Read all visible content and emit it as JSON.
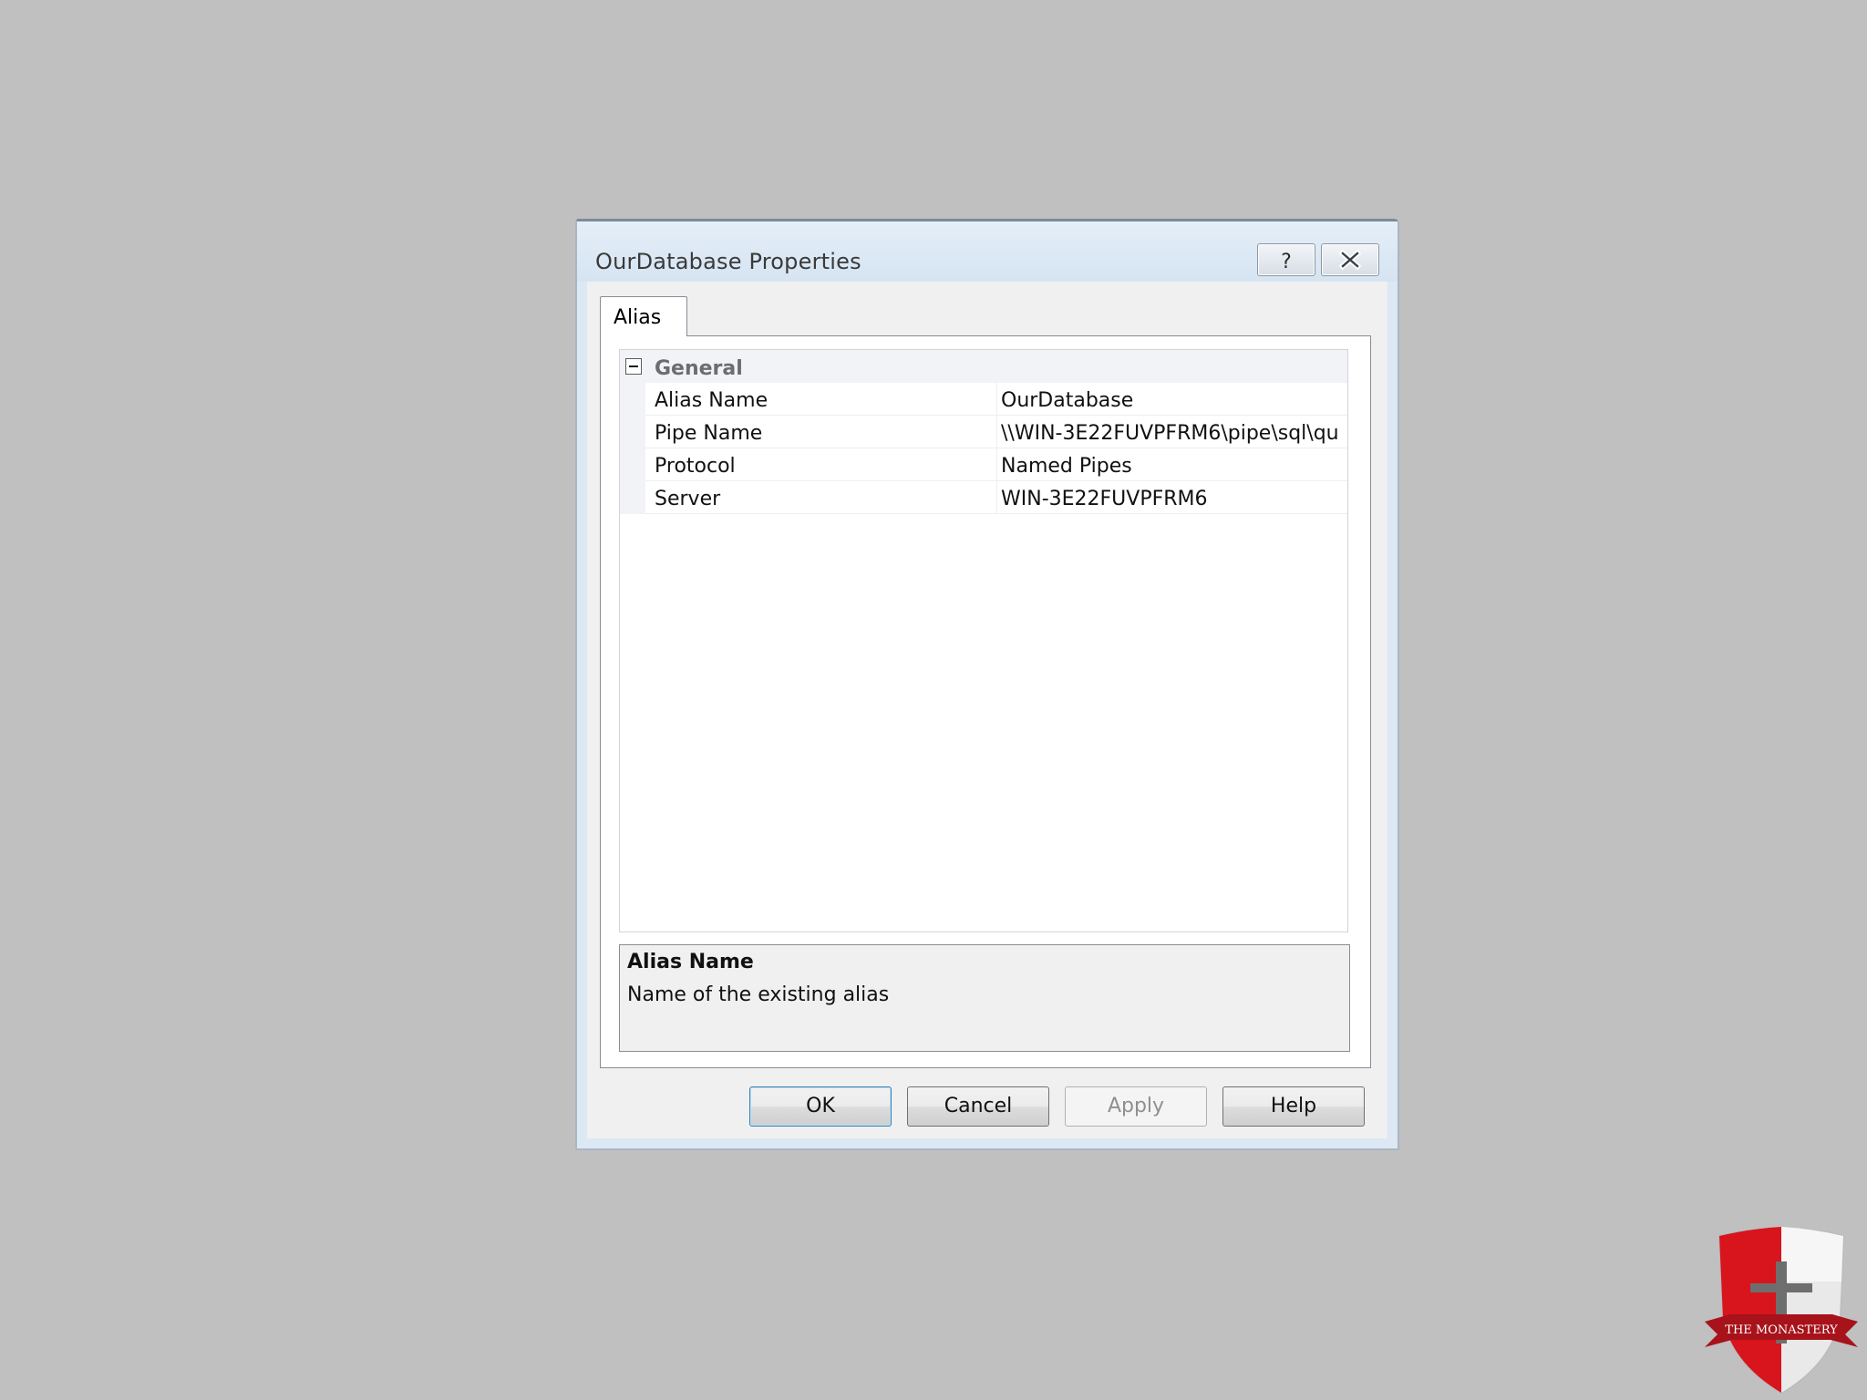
{
  "window": {
    "title": "OurDatabase Properties",
    "help_glyph": "?",
    "close_icon": "close-icon"
  },
  "tabs": [
    {
      "label": "Alias",
      "selected": true
    }
  ],
  "property_grid": {
    "category": {
      "label": "General",
      "expanded": true
    },
    "properties": [
      {
        "name": "Alias Name",
        "value": "OurDatabase"
      },
      {
        "name": "Pipe Name",
        "value": "\\\\WIN-3E22FUVPFRM6\\pipe\\sql\\qu"
      },
      {
        "name": "Protocol",
        "value": "Named Pipes"
      },
      {
        "name": "Server",
        "value": "WIN-3E22FUVPFRM6"
      }
    ]
  },
  "description": {
    "title": "Alias Name",
    "text": "Name of the existing alias"
  },
  "buttons": {
    "ok": "OK",
    "cancel": "Cancel",
    "apply": "Apply",
    "help": "Help",
    "apply_enabled": false
  },
  "logo": {
    "text": "THE MONASTERY",
    "colors": {
      "shield_red": "#d8141c",
      "shield_white": "#f2f2f2",
      "ribbon": "#a8121a"
    }
  }
}
